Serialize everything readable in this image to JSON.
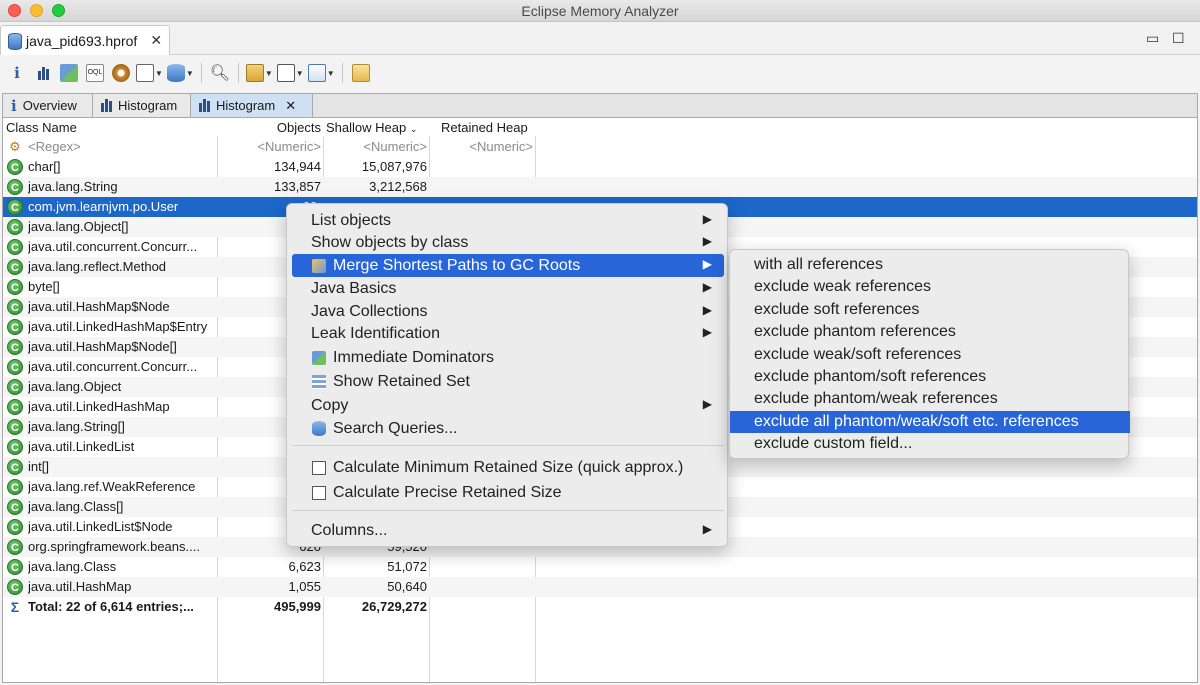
{
  "window": {
    "title": "Eclipse Memory Analyzer"
  },
  "editor_tab": {
    "label": "java_pid693.hprof"
  },
  "view_tabs": [
    {
      "label": "Overview"
    },
    {
      "label": "Histogram"
    },
    {
      "label": "Histogram"
    }
  ],
  "table": {
    "headers": {
      "class_name": "Class Name",
      "objects": "Objects",
      "shallow": "Shallow Heap",
      "retained": "Retained Heap"
    },
    "filter": {
      "class_name": "<Regex>",
      "objects": "<Numeric>",
      "shallow": "<Numeric>",
      "retained": "<Numeric>"
    },
    "rows": [
      {
        "name": "char[]",
        "objects": "134,944",
        "shallow": "15,087,976"
      },
      {
        "name": "java.lang.String",
        "objects": "133,857",
        "shallow": "3,212,568"
      },
      {
        "name": "com.jvm.learnjvm.po.User",
        "objects": "99,",
        "shallow": ""
      },
      {
        "name": "java.lang.Object[]",
        "objects": "2",
        "shallow": ""
      },
      {
        "name": "java.util.concurrent.Concurr...",
        "objects": "13",
        "shallow": ""
      },
      {
        "name": "java.lang.reflect.Method",
        "objects": "3",
        "shallow": ""
      },
      {
        "name": "byte[]",
        "objects": "",
        "shallow": ""
      },
      {
        "name": "java.util.HashMap$Node",
        "objects": "8",
        "shallow": ""
      },
      {
        "name": "java.util.LinkedHashMap$Entry",
        "objects": "6",
        "shallow": ""
      },
      {
        "name": "java.util.HashMap$Node[]",
        "objects": "2",
        "shallow": ""
      },
      {
        "name": "java.util.concurrent.Concurr...",
        "objects": "",
        "shallow": ""
      },
      {
        "name": "java.lang.Object",
        "objects": "9",
        "shallow": ""
      },
      {
        "name": "java.util.LinkedHashMap",
        "objects": "2",
        "shallow": ""
      },
      {
        "name": "java.lang.String[]",
        "objects": "",
        "shallow": ""
      },
      {
        "name": "java.util.LinkedList",
        "objects": "2",
        "shallow": ""
      },
      {
        "name": "int[]",
        "objects": "",
        "shallow": ""
      },
      {
        "name": "java.lang.ref.WeakReference",
        "objects": "2",
        "shallow": ""
      },
      {
        "name": "java.lang.Class[]",
        "objects": "2",
        "shallow": ""
      },
      {
        "name": "java.util.LinkedList$Node",
        "objects": "2",
        "shallow": ""
      },
      {
        "name": "org.springframework.beans....",
        "objects": "620",
        "shallow": "59,520"
      },
      {
        "name": "java.lang.Class",
        "objects": "6,623",
        "shallow": "51,072"
      },
      {
        "name": "java.util.HashMap",
        "objects": "1,055",
        "shallow": "50,640"
      }
    ],
    "total": {
      "name": "Total: 22 of 6,614 entries;...",
      "objects": "495,999",
      "shallow": "26,729,272"
    }
  },
  "context_menu": {
    "items": [
      "List objects",
      "Show objects by class",
      "Merge Shortest Paths to GC Roots",
      "Java Basics",
      "Java Collections",
      "Leak Identification",
      "Immediate Dominators",
      "Show Retained Set",
      "Copy",
      "Search Queries...",
      "Calculate Minimum Retained Size (quick approx.)",
      "Calculate Precise Retained Size",
      "Columns..."
    ]
  },
  "submenu": {
    "items": [
      "with all references",
      "exclude weak references",
      "exclude soft references",
      "exclude phantom references",
      "exclude weak/soft references",
      "exclude phantom/soft references",
      "exclude phantom/weak references",
      "exclude all phantom/weak/soft etc. references",
      "exclude custom field..."
    ]
  },
  "colors": {
    "selection": "#1d67c9",
    "menu_highlight": "#2765d8",
    "class_icon": "#3a9a3c"
  }
}
